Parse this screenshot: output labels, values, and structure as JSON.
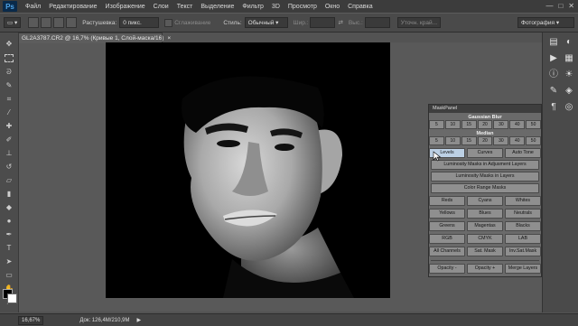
{
  "app": {
    "logo": "Ps"
  },
  "menu": [
    "Файл",
    "Редактирование",
    "Изображение",
    "Слои",
    "Текст",
    "Выделение",
    "Фильтр",
    "3D",
    "Просмотр",
    "Окно",
    "Справка"
  ],
  "options": {
    "feather_label": "Растушевка:",
    "feather_value": "0 пикс.",
    "antialias": "Сглаживание",
    "style_label": "Стиль:",
    "style_value": "Обычный",
    "width_label": "Шир.:",
    "height_label": "Выс.:",
    "refine": "Уточн. край...",
    "workspace": "Фотография"
  },
  "document": {
    "tab_title": "GL2A3787.CR2 @ 16,7% (Кривые 1, Слой-маска/16)",
    "tab_close": "×"
  },
  "mask_panel": {
    "title": "MaskPanel",
    "gaussian_label": "Gaussian Blur",
    "gaussian_values": [
      "5",
      "10",
      "15",
      "20",
      "30",
      "40",
      "50"
    ],
    "median_label": "Median",
    "median_values": [
      "5",
      "10",
      "15",
      "20",
      "30",
      "40",
      "50"
    ],
    "tabs": [
      "Levels",
      "Curves",
      "Auto Tone"
    ],
    "lum_adj": "Luminosity Masks in Adjusment Layers",
    "lum_layers": "Luminosity Masks in Layers",
    "color_range": "Color Range Masks",
    "color_buttons": [
      [
        "Reds",
        "Cyans",
        "Whites"
      ],
      [
        "Yellows",
        "Blues",
        "Neutrals"
      ],
      [
        "Greens",
        "Magentas",
        "Blacks"
      ],
      [
        "RGB",
        "CMYK",
        "LAB"
      ],
      [
        "All Channels",
        "Sat. Mask",
        "Inv.Sat.Mask"
      ]
    ],
    "bottom_buttons": [
      "Opacity -",
      "Opacity +",
      "Merge Layers"
    ]
  },
  "status": {
    "zoom": "16,67%",
    "doc_info": "Док: 126,4M/210,9M",
    "arrow": "▶"
  }
}
